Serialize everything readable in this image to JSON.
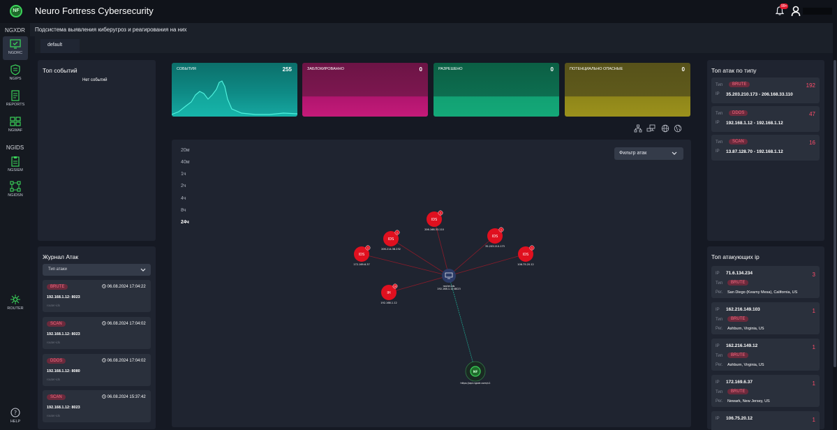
{
  "app": {
    "title": "Neuro Fortress Cybersecurity",
    "logo": "NF",
    "notif_count": "99+"
  },
  "subtitle": "Подсистема выявления киберугроз и реагирования на них",
  "sidebar": {
    "section1": "NGXDR",
    "section2": "NGIDS",
    "items": [
      {
        "label": "NGDRC",
        "icon": "monitor-check-icon"
      },
      {
        "label": "NGIPS",
        "icon": "shield-grid-icon"
      },
      {
        "label": "REPORTS",
        "icon": "report-icon"
      },
      {
        "label": "NGWAF",
        "icon": "firewall-icon"
      },
      {
        "label": "NGSIEM",
        "icon": "clipboard-icon"
      },
      {
        "label": "NGIDSN",
        "icon": "network-icon"
      },
      {
        "label": "ROUTER",
        "icon": "router-icon"
      },
      {
        "label": "HELP",
        "icon": "help-icon"
      }
    ]
  },
  "tabs": [
    {
      "label": "default"
    }
  ],
  "top_events": {
    "title": "Топ событий",
    "empty": "Нет событий"
  },
  "stats": [
    {
      "label": "СОБЫТИЯ",
      "value": "255",
      "color": "#0fa39a"
    },
    {
      "label": "ЗАБЛОКИРОВАННО",
      "value": "0",
      "color": "#a3145f"
    },
    {
      "label": "РАЗРЕШЕНО",
      "value": "0",
      "color": "#0f9464"
    },
    {
      "label": "ПОТЕНЦИАЛЬНО ОПАСНЫЕ",
      "value": "0",
      "color": "#8f8418"
    }
  ],
  "graph": {
    "time_options": [
      "20м",
      "40м",
      "1ч",
      "2ч",
      "4ч",
      "8ч",
      "24ч"
    ],
    "selected_time": "24ч",
    "filter_label": "Фильтр атак",
    "nodes": [
      {
        "label": "IDS",
        "sub": "206.168.33.110",
        "badge": "1"
      },
      {
        "label": "IDS",
        "sub": "206.214.38.232",
        "badge": "1"
      },
      {
        "label": "IDS",
        "sub": "35.203.210.173",
        "badge": "1"
      },
      {
        "label": "IDS",
        "sub": "172.169.6.37",
        "badge": "1"
      },
      {
        "label": "IDS",
        "sub": "106.75.20.12",
        "badge": "1"
      },
      {
        "label": "IH",
        "sub": "192.168.1.12",
        "badge": "10"
      }
    ],
    "center": {
      "label": "router-ids",
      "sub": "192.168.1.12:8023"
    },
    "hub": {
      "label": "NF",
      "sub": "https://api.ngxdr.com/v1"
    }
  },
  "journal": {
    "title": "Журнал Атак",
    "filter_label": "Тип атаки",
    "items": [
      {
        "type": "BRUTE",
        "date": "06.08.2024  17:04:22",
        "ip": "192.168.1.12: 8023",
        "source": "router-ids"
      },
      {
        "type": "SCAN",
        "date": "06.08.2024  17:04:02",
        "ip": "192.168.1.12: 8023",
        "source": "router-ids"
      },
      {
        "type": "DDOS",
        "date": "06.08.2024  17:04:02",
        "ip": "192.168.1.12: 8080",
        "source": "router-ids"
      },
      {
        "type": "SCAN",
        "date": "06.08.2024  15:37:42",
        "ip": "192.168.1.12: 8023",
        "source": "router-ids"
      }
    ]
  },
  "top_types": {
    "title": "Топ атак по типу",
    "type_key": "Тип",
    "ip_key": "IP",
    "items": [
      {
        "type": "BRUTE",
        "count": "192",
        "ip": "35.203.210.173 - 206.168.33.110"
      },
      {
        "type": "DDOS",
        "count": "47",
        "ip": "192.168.1.12 - 192.168.1.12"
      },
      {
        "type": "SCAN",
        "count": "16",
        "ip": "13.87.128.70 - 192.168.1.12"
      }
    ]
  },
  "top_ips": {
    "title": "Топ атакующих ip",
    "ip_key": "IP",
    "type_key": "Тип",
    "region_key": "Рег.",
    "items": [
      {
        "ip": "71.6.134.234",
        "type": "BRUTE",
        "region": "San Diego (Kearny Mesa), California, US",
        "count": "3"
      },
      {
        "ip": "162.216.149.103",
        "type": "BRUTE",
        "region": "Ashburn, Virginia, US",
        "count": "1"
      },
      {
        "ip": "162.216.149.12",
        "type": "BRUTE",
        "region": "Ashburn, Virginia, US",
        "count": "1"
      },
      {
        "ip": "172.169.6.37",
        "type": "BRUTE",
        "region": "Newark, New Jersey, US",
        "count": "1"
      },
      {
        "ip": "106.75.20.12",
        "count": "1"
      }
    ]
  }
}
